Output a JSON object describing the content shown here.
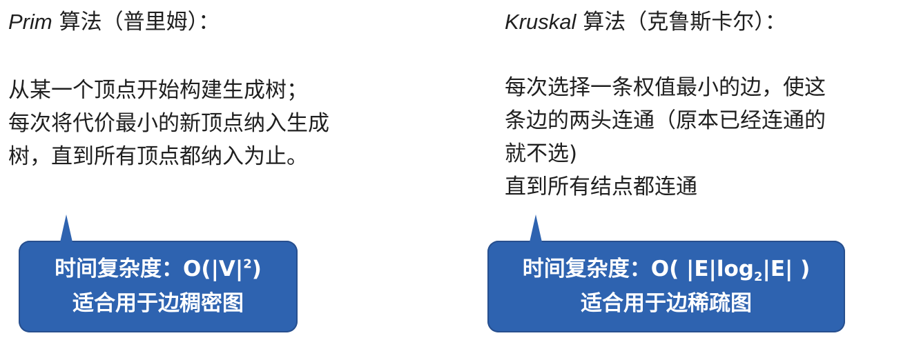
{
  "prim": {
    "title_latin": "Prim",
    "title_rest": " 算法（普里姆）：",
    "lines": [
      "从某一个顶点开始构建生成树；",
      "每次将代价最小的新顶点纳入生成",
      "树，直到所有顶点都纳入为止。"
    ],
    "callout": {
      "complexity_prefix": "时间复杂度：O(|V|",
      "complexity_sup": "2",
      "complexity_suffix": ")",
      "suitability": "适合用于边稠密图"
    }
  },
  "kruskal": {
    "title_latin": "Kruskal",
    "title_rest": " 算法（克鲁斯卡尔）：",
    "lines": [
      "每次选择一条权值最小的边，使这",
      "条边的两头连通（原本已经连通的",
      "就不选)",
      "直到所有结点都连通"
    ],
    "callout": {
      "complexity_prefix": "时间复杂度：O( |E|log",
      "complexity_sub": "2",
      "complexity_suffix": "|E| )",
      "suitability": "适合用于边稀疏图"
    }
  },
  "colors": {
    "callout_fill": "#2e63b0",
    "text": "#1f1f1f"
  }
}
